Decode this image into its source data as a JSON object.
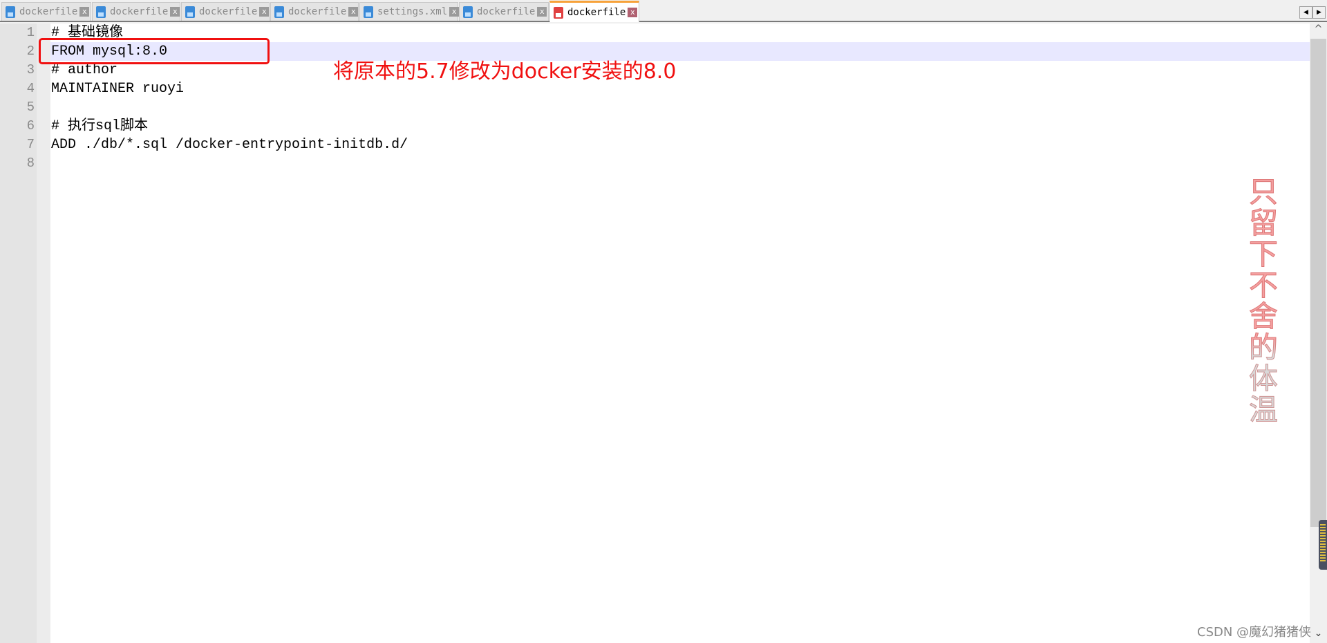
{
  "tabs": [
    {
      "label": "dockerfile",
      "active": false
    },
    {
      "label": "dockerfile",
      "active": false
    },
    {
      "label": "dockerfile",
      "active": false
    },
    {
      "label": "dockerfile",
      "active": false
    },
    {
      "label": "settings.xml",
      "active": false
    },
    {
      "label": "dockerfile",
      "active": false
    },
    {
      "label": "dockerfile",
      "active": true
    }
  ],
  "close_glyph": "x",
  "nav": {
    "prev": "◀",
    "next": "▶"
  },
  "lines": [
    {
      "n": "1",
      "text": "# 基础镜像"
    },
    {
      "n": "2",
      "text": "FROM mysql:8.0"
    },
    {
      "n": "3",
      "text": "# author"
    },
    {
      "n": "4",
      "text": "MAINTAINER ruoyi"
    },
    {
      "n": "5",
      "text": ""
    },
    {
      "n": "6",
      "text": "# 执行sql脚本"
    },
    {
      "n": "7",
      "text": "ADD ./db/*.sql /docker-entrypoint-initdb.d/"
    },
    {
      "n": "8",
      "text": ""
    }
  ],
  "annotation": "将原本的5.7修改为docker安装的8.0",
  "annotation_color": "#f01010",
  "watermark_vertical": "只留下不舍的体温",
  "csdn_watermark": "CSDN @魔幻猪猪侠",
  "scroll": {
    "up": "^",
    "down": "⌄"
  }
}
